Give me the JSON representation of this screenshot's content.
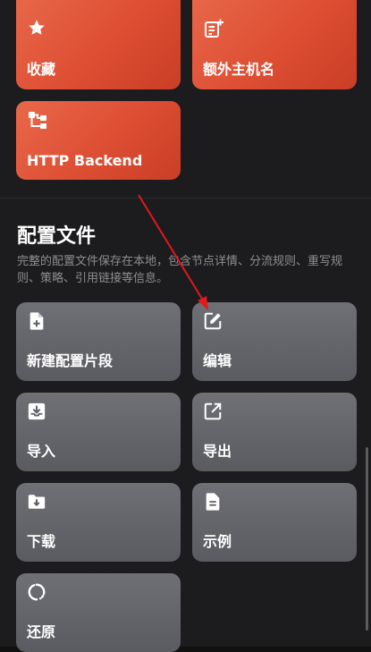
{
  "top_tiles": {
    "favorites_label": "收藏",
    "extra_hostname_label": "额外主机名",
    "http_backend_label": "HTTP Backend"
  },
  "config_section": {
    "title": "配置文件",
    "description": "完整的配置文件保存在本地，包含节点详情、分流规则、重写规则、策略、引用链接等信息。"
  },
  "config_tiles": {
    "new_snippet_label": "新建配置片段",
    "edit_label": "编辑",
    "import_label": "导入",
    "export_label": "导出",
    "download_label": "下载",
    "example_label": "示例",
    "restore_label": "还原"
  },
  "colors": {
    "orange_tile": "#dd4e33",
    "gray_tile": "#636469",
    "annotation_arrow": "#e0191b"
  }
}
